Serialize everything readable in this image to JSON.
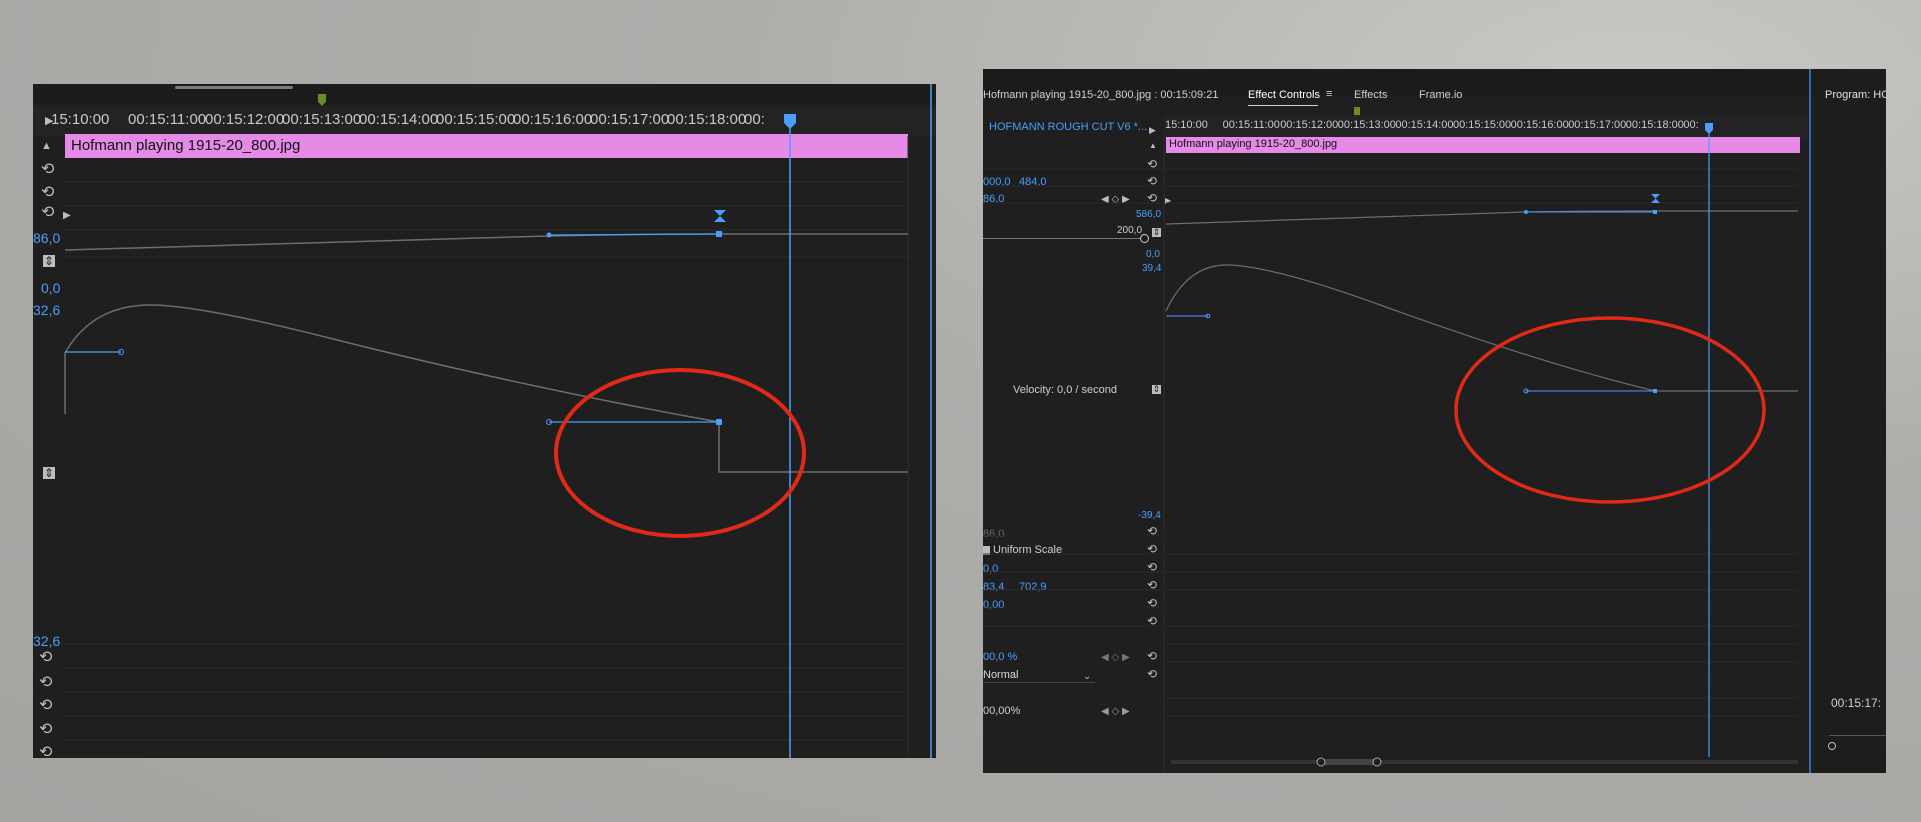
{
  "left": {
    "ruler": [
      "15:10:00",
      "00:15:11:00",
      "00:15:12:00",
      "00:15:13:00",
      "00:15:14:00",
      "00:15:15:00",
      "00:15:16:00",
      "00:15:17:00",
      "00:15:18:00",
      "00:"
    ],
    "clip_name": "Hofmann playing 1915-20_800.jpg",
    "value_labels": {
      "v1": "86,0",
      "v2": "0,0",
      "v3": "32,6",
      "v4": "32,6"
    }
  },
  "right": {
    "header_title": "Hofmann playing 1915-20_800.jpg : 00:15:09:21",
    "tabs": {
      "effect_controls": "Effect Controls",
      "effects": "Effects",
      "frameio": "Frame.io"
    },
    "sequence_name": "HOFMANN ROUGH CUT V6 *...",
    "ruler": [
      "15:10:00",
      "00:15:11:00",
      "00:15:12:00",
      "00:15:13:00",
      "00:15:14:00",
      "00:15:15:00",
      "00:15:16:00",
      "00:15:17:00",
      "00:15:18:00",
      "00:"
    ],
    "clip_name": "Hofmann playing 1915-20_800.jpg",
    "params": {
      "pos_x": "000,0",
      "pos_y": "484,0",
      "scale": "86,0",
      "graph_max": "586,0",
      "graph_200": "200,0",
      "zero": "0,0",
      "vel_max": "39,4",
      "velocity": "Velocity: 0,0 / second",
      "vel_min": "-39,4",
      "scale_width": "86,0",
      "uniform_scale": "Uniform Scale",
      "rotation": "0,0",
      "anchor_x": "83,4",
      "anchor_y": "702,9",
      "flicker": "0,00",
      "opacity": "00,0 %",
      "blend_mode": "Normal",
      "time_remap": "00,00%"
    },
    "program_label": "Program: HC",
    "program_timecode": "00:15:17:"
  },
  "colors": {
    "accent": "#4a9eff",
    "clip": "#e58ae6",
    "panel": "#1f1f1f",
    "annotation": "#e02a17"
  },
  "icons": [
    "reset-icon",
    "keyframe-nav-icon",
    "play-triangle-icon",
    "playhead-icon",
    "ease-keyframe-icon",
    "toggle-graph-icon",
    "menu-icon"
  ]
}
